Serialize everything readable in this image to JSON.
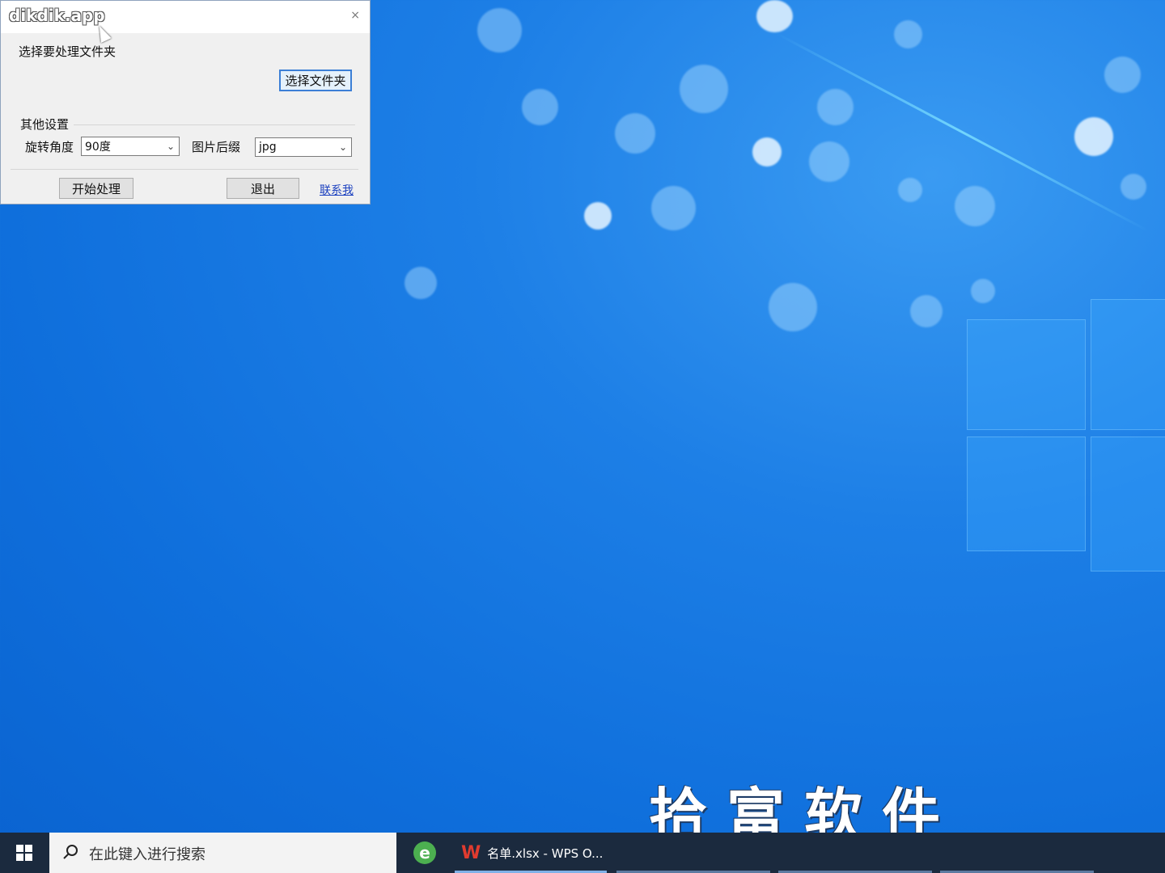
{
  "watermark": {
    "logo": "dikdik.app",
    "brand": "拾富软件"
  },
  "dialog": {
    "close_label": "×",
    "folder_prompt": "选择要处理文件夹",
    "choose_folder_button": "选择文件夹",
    "other_settings_label": "其他设置",
    "rotation_label": "旋转角度",
    "rotation_value": "90度",
    "suffix_label": "图片后缀",
    "suffix_value": "jpg",
    "start_button": "开始处理",
    "exit_button": "退出",
    "contact_link": "联系我"
  },
  "taskbar": {
    "search_placeholder": "在此键入进行搜索",
    "apps": [
      {
        "icon": "ie-icon",
        "label": ""
      },
      {
        "icon": "wps-icon",
        "label": "名单.xlsx - WPS O..."
      }
    ]
  },
  "colors": {
    "desktop": "#1d7fe6",
    "taskbar": "#1b2a3e",
    "link": "#1a3fbf",
    "focus_border": "#3c7fd6"
  }
}
